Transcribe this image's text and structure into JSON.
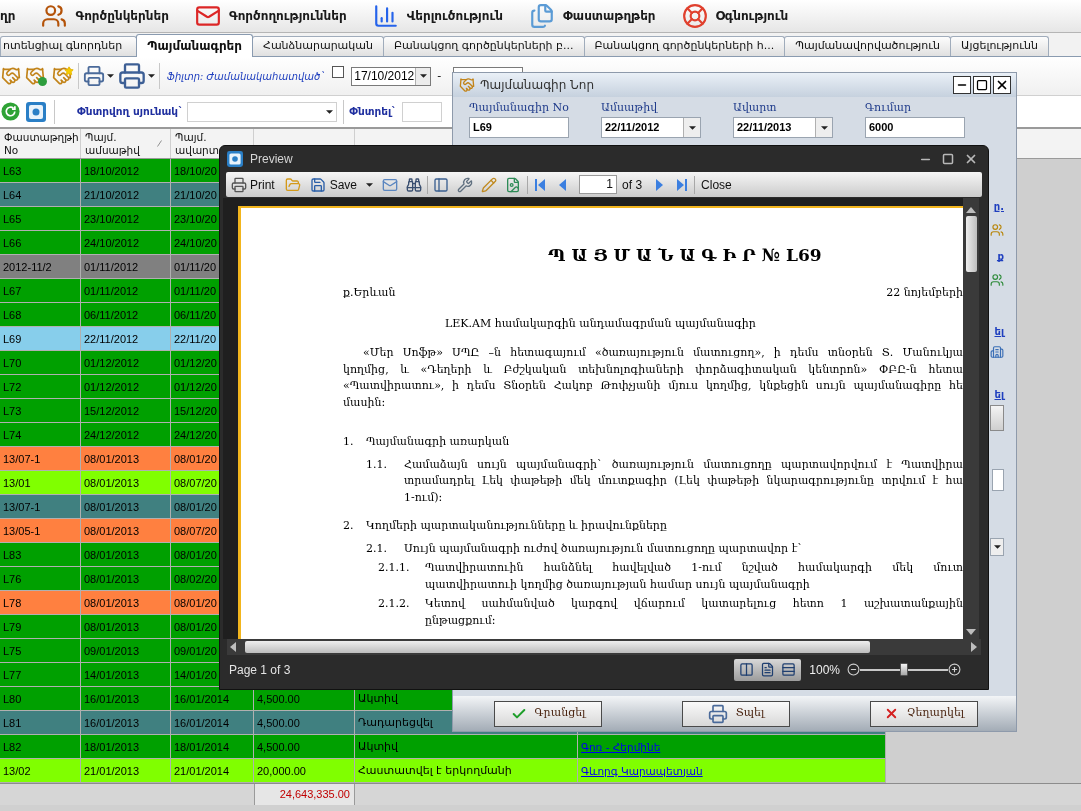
{
  "menu": {
    "items": [
      {
        "label": "ղր"
      },
      {
        "label": "Գործընկերներ"
      },
      {
        "label": "Գործողություններ"
      },
      {
        "label": "Վերլուծություն"
      },
      {
        "label": "Փաստաթղթեր"
      },
      {
        "label": "Օգնություն"
      }
    ]
  },
  "tabs": [
    {
      "label": "ոտենցիալ գնորդներ",
      "selected": false
    },
    {
      "label": "Պայմանագրեր",
      "selected": true
    },
    {
      "label": "Հանձնարարական",
      "selected": false
    },
    {
      "label": "Բանակցող գործընկերների բ...",
      "selected": false
    },
    {
      "label": "Բանակցող գործընկերների հ...",
      "selected": false
    },
    {
      "label": "Պայմանավորվածություն",
      "selected": false
    },
    {
      "label": "Այցելությունն",
      "selected": false
    }
  ],
  "toolbar": {
    "filter_label": "Ֆիլտր: Ժամանակահատված`",
    "period_checkbox": {
      "checked": false
    },
    "date_from": "17/10/2012",
    "range_separator": "-"
  },
  "search_bar": {
    "column_label": "Փնտրվող սյունակ`",
    "search_label": "Փնտրել`"
  },
  "table": {
    "columns": [
      {
        "label": "Փաստաթղթի No",
        "sorted": false
      },
      {
        "label": "Պայմ. ամսաթիվ",
        "sorted": true
      },
      {
        "label": "Պայմ. ավարտ",
        "sorted": false
      }
    ],
    "rows": [
      {
        "no": "L63",
        "date": "18/10/2012",
        "end": "18/10/20",
        "color": "#00a000",
        "selected": false
      },
      {
        "no": "L64",
        "date": "21/10/2012",
        "end": "21/10/20",
        "color": "#408080",
        "selected": false
      },
      {
        "no": "L65",
        "date": "23/10/2012",
        "end": "23/10/20",
        "color": "#00a000",
        "selected": false
      },
      {
        "no": "L66",
        "date": "24/10/2012",
        "end": "24/10/20",
        "color": "#00a000",
        "selected": false
      },
      {
        "no": "2012-11/2",
        "date": "01/11/2012",
        "end": "01/11/20",
        "color": "#808080",
        "selected": false
      },
      {
        "no": "L67",
        "date": "01/11/2012",
        "end": "01/11/20",
        "color": "#00a000",
        "selected": false
      },
      {
        "no": "L68",
        "date": "06/11/2012",
        "end": "06/11/20",
        "color": "#00a000",
        "selected": false
      },
      {
        "no": "L69",
        "date": "22/11/2012",
        "end": "22/11/20",
        "selected": true
      },
      {
        "no": "L70",
        "date": "01/12/2012",
        "end": "01/12/20",
        "color": "#00a000",
        "selected": false
      },
      {
        "no": "L72",
        "date": "01/12/2012",
        "end": "01/12/20",
        "color": "#00a000",
        "selected": false
      },
      {
        "no": "L73",
        "date": "15/12/2012",
        "end": "15/12/20",
        "color": "#00a000",
        "selected": false
      },
      {
        "no": "L74",
        "date": "24/12/2012",
        "end": "24/12/20",
        "color": "#00a000",
        "selected": false
      },
      {
        "no": "13/07-1",
        "date": "08/01/2013",
        "end": "08/01/20",
        "color": "#ff8040",
        "selected": false
      },
      {
        "no": "13/01",
        "date": "08/01/2013",
        "end": "08/07/20",
        "color": "#80ff00",
        "selected": false
      },
      {
        "no": "13/07-1",
        "date": "08/01/2013",
        "end": "08/01/20",
        "color": "#408080",
        "selected": false
      },
      {
        "no": "13/05-1",
        "date": "08/01/2013",
        "end": "08/07/20",
        "color": "#ff8040",
        "selected": false
      },
      {
        "no": "L83",
        "date": "08/01/2013",
        "end": "08/01/20",
        "color": "#00a000",
        "selected": false
      },
      {
        "no": "L76",
        "date": "08/01/2013",
        "end": "08/02/20",
        "color": "#00a000",
        "selected": false
      },
      {
        "no": "L78",
        "date": "08/01/2013",
        "end": "08/01/20",
        "color": "#ff8040",
        "selected": false
      },
      {
        "no": "L79",
        "date": "08/01/2013",
        "end": "08/01/20",
        "color": "#00a000",
        "selected": false
      },
      {
        "no": "L75",
        "date": "09/01/2013",
        "end": "09/01/20",
        "color": "#00a000",
        "selected": false
      },
      {
        "no": "L77",
        "date": "14/01/2013",
        "end": "14/01/20",
        "color": "#00a000",
        "selected": false
      },
      {
        "no": "L80",
        "date": "16/01/2013",
        "end": "16/01/2014",
        "amount": "4,500.00",
        "status": "Ակտիվ",
        "color": "#00a000",
        "selected": false
      },
      {
        "no": "L81",
        "date": "16/01/2013",
        "end": "16/01/2014",
        "amount": "4,500.00",
        "status": "Դադարեցվել",
        "color": "#408080",
        "selected": false
      },
      {
        "no": "L82",
        "date": "18/01/2013",
        "end": "18/01/2014",
        "amount": "4,500.00",
        "status": "Ակտիվ",
        "person": "Գոռ - Հերմինե",
        "color": "#00a000",
        "selected": false
      },
      {
        "no": "13/02",
        "date": "21/01/2013",
        "end": "21/01/2014",
        "amount": "20,000.00",
        "status": "Հաստատվել է երկողմանի",
        "person": "Գևորգ Կարապետյան",
        "color": "#80ff00",
        "selected": false
      }
    ],
    "total": "24,643,335.00"
  },
  "dialog": {
    "title": "Պայմանագիր Նոր",
    "fields": [
      {
        "label": "Պայմանագիր No",
        "value": "L69",
        "kind": "text"
      },
      {
        "label": "Ամսաթիվ",
        "value": "22/11/2012",
        "kind": "date"
      },
      {
        "label": "Ավարտ",
        "value": "22/11/2013",
        "kind": "date"
      },
      {
        "label": "Գումար",
        "value": "6000",
        "kind": "text"
      }
    ],
    "side_links": [
      "ը.",
      "ք",
      "ել",
      "ել"
    ],
    "buttons": [
      {
        "label": "Գրանցել"
      },
      {
        "label": "Տպել"
      },
      {
        "label": "Չեղարկել"
      }
    ]
  },
  "preview": {
    "title": "Preview",
    "toolbar": {
      "print": "Print",
      "save": "Save",
      "page": "1",
      "page_count": "of 3",
      "close": "Close"
    },
    "document": {
      "title": "Պ Ա Յ Մ Ա Ն Ա Գ Ի Ր № L69",
      "city": "ք.Երևան",
      "date": "22 նոյեմբերի",
      "subtitle": "LEK.AM համակարգին անդամագրման պայմանագիր",
      "intro": [
        "«Մեր Սոֆթ» ՍՊԸ –ն հետագայում «ծառայություն մատուցող», ի դեմս տնօրեն Տ. Մանուկյա",
        "կողմից, և «Դեղերի և Բժշկական տեխնոլոգիաների փորձագիտական կենտրոն» ՓԲԸ-ն հետա",
        "«Պատվիրատու», ի դեմս Տնօրեն Հակոբ Թոփչյանի մյուս կողմից, կնքեցին սույն պայմանագիրը հե",
        "մասին:"
      ],
      "sections": [
        {
          "number": "1.",
          "lines": [
            "Պայմանագրի առարկան"
          ],
          "children": [
            {
              "number": "1.1.",
              "lines": [
                "Համաձայն սույն պայմանագրի` ծառայություն մատուցողը պարտավորվում է Պատվիրա",
                "տրամադրել Լեկ փաթեթի մեկ մուտքագիր (Լեկ փաթեթի նկարագրությունը տրվում է հա",
                "1-ում):"
              ]
            }
          ]
        },
        {
          "number": "2.",
          "lines": [
            "Կողմերի պարտականությունները և իրավունքները"
          ],
          "children": [
            {
              "number": "2.1.",
              "lines": [
                "Սույն պայմանագրի ուժով ծառայություն մատուցողը պարտավոր է`"
              ],
              "children": [
                {
                  "number": "2.1.1.",
                  "lines": [
                    "Պատվիրատուին հանձնել հավելված 1-ում նշված համակարգի մեկ մուտ",
                    "պատվիրատուի կողմից ծառայության համար սույն պայմանագրի"
                  ]
                },
                {
                  "number": "2.1.2.",
                  "lines": [
                    "Կետով սահմանված կարգով վճարում կատարելուց հետո 1 աշխատանքային",
                    "ընթացքում:"
                  ]
                }
              ]
            }
          ]
        }
      ]
    },
    "status": "Page 1 of 3",
    "zoom": {
      "reading": "100%",
      "level": 0.5
    }
  }
}
